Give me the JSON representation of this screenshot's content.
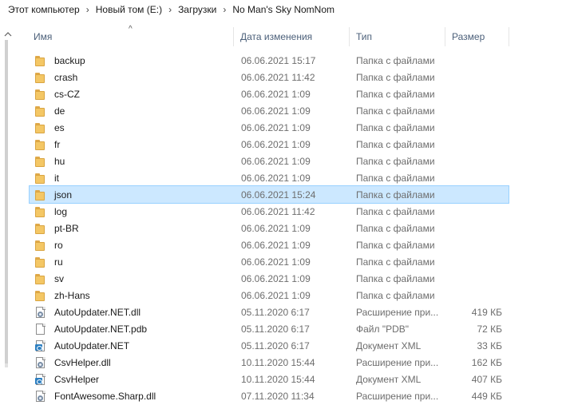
{
  "breadcrumb": [
    {
      "label": "Этот компьютер"
    },
    {
      "label": "Новый том (E:)"
    },
    {
      "label": "Загрузки"
    },
    {
      "label": "No Man's Sky NomNom"
    }
  ],
  "columns": {
    "name": "Имя",
    "date": "Дата изменения",
    "type": "Тип",
    "size": "Размер"
  },
  "icons": {
    "folder": "folder-icon",
    "dll": "dll-file-icon",
    "pdb": "file-icon",
    "xml": "xml-file-icon",
    "sort": "sort-ascending-icon"
  },
  "colors": {
    "selection": "#cce8ff",
    "selection_border": "#99d1ff",
    "header_text": "#4c607a",
    "folder": "#f4c765"
  },
  "files": [
    {
      "name": "backup",
      "date": "06.06.2021 15:17",
      "type": "Папка с файлами",
      "size": "",
      "icon": "folder"
    },
    {
      "name": "crash",
      "date": "06.06.2021 11:42",
      "type": "Папка с файлами",
      "size": "",
      "icon": "folder"
    },
    {
      "name": "cs-CZ",
      "date": "06.06.2021 1:09",
      "type": "Папка с файлами",
      "size": "",
      "icon": "folder"
    },
    {
      "name": "de",
      "date": "06.06.2021 1:09",
      "type": "Папка с файлами",
      "size": "",
      "icon": "folder"
    },
    {
      "name": "es",
      "date": "06.06.2021 1:09",
      "type": "Папка с файлами",
      "size": "",
      "icon": "folder"
    },
    {
      "name": "fr",
      "date": "06.06.2021 1:09",
      "type": "Папка с файлами",
      "size": "",
      "icon": "folder"
    },
    {
      "name": "hu",
      "date": "06.06.2021 1:09",
      "type": "Папка с файлами",
      "size": "",
      "icon": "folder"
    },
    {
      "name": "it",
      "date": "06.06.2021 1:09",
      "type": "Папка с файлами",
      "size": "",
      "icon": "folder"
    },
    {
      "name": "json",
      "date": "06.06.2021 15:24",
      "type": "Папка с файлами",
      "size": "",
      "icon": "folder",
      "selected": true
    },
    {
      "name": "log",
      "date": "06.06.2021 11:42",
      "type": "Папка с файлами",
      "size": "",
      "icon": "folder"
    },
    {
      "name": "pt-BR",
      "date": "06.06.2021 1:09",
      "type": "Папка с файлами",
      "size": "",
      "icon": "folder"
    },
    {
      "name": "ro",
      "date": "06.06.2021 1:09",
      "type": "Папка с файлами",
      "size": "",
      "icon": "folder"
    },
    {
      "name": "ru",
      "date": "06.06.2021 1:09",
      "type": "Папка с файлами",
      "size": "",
      "icon": "folder"
    },
    {
      "name": "sv",
      "date": "06.06.2021 1:09",
      "type": "Папка с файлами",
      "size": "",
      "icon": "folder"
    },
    {
      "name": "zh-Hans",
      "date": "06.06.2021 1:09",
      "type": "Папка с файлами",
      "size": "",
      "icon": "folder"
    },
    {
      "name": "AutoUpdater.NET.dll",
      "date": "05.11.2020 6:17",
      "type": "Расширение при...",
      "size": "419 КБ",
      "icon": "dll"
    },
    {
      "name": "AutoUpdater.NET.pdb",
      "date": "05.11.2020 6:17",
      "type": "Файл \"PDB\"",
      "size": "72 КБ",
      "icon": "pdb"
    },
    {
      "name": "AutoUpdater.NET",
      "date": "05.11.2020 6:17",
      "type": "Документ XML",
      "size": "33 КБ",
      "icon": "xml"
    },
    {
      "name": "CsvHelper.dll",
      "date": "10.11.2020 15:44",
      "type": "Расширение при...",
      "size": "162 КБ",
      "icon": "dll"
    },
    {
      "name": "CsvHelper",
      "date": "10.11.2020 15:44",
      "type": "Документ XML",
      "size": "407 КБ",
      "icon": "xml"
    },
    {
      "name": "FontAwesome.Sharp.dll",
      "date": "07.11.2020 11:34",
      "type": "Расширение при...",
      "size": "449 КБ",
      "icon": "dll"
    }
  ]
}
